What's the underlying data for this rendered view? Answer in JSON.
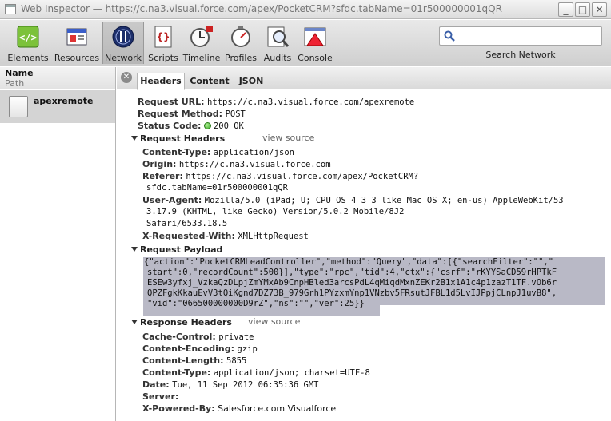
{
  "window": {
    "title": "Web Inspector — https://c.na3.visual.force.com/apex/PocketCRM?sfdc.tabName=01r500000001qQR",
    "min": "_",
    "max": "□",
    "close": "✕"
  },
  "toolbar": {
    "items": [
      {
        "label": "Elements",
        "icon": "elements-icon"
      },
      {
        "label": "Resources",
        "icon": "resources-icon"
      },
      {
        "label": "Network",
        "icon": "network-icon"
      },
      {
        "label": "Scripts",
        "icon": "scripts-icon"
      },
      {
        "label": "Timeline",
        "icon": "timeline-icon"
      },
      {
        "label": "Profiles",
        "icon": "profiles-icon"
      },
      {
        "label": "Audits",
        "icon": "audits-icon"
      },
      {
        "label": "Console",
        "icon": "console-icon"
      }
    ],
    "selected": "Network",
    "search": {
      "value": "",
      "placeholder": "",
      "caption": "Search Network"
    }
  },
  "left": {
    "header_name": "Name",
    "header_path": "Path",
    "rows": [
      {
        "name": "apexremote"
      }
    ]
  },
  "tabs": [
    {
      "label": "Headers",
      "active": true
    },
    {
      "label": "Content",
      "active": false
    },
    {
      "label": "JSON",
      "active": false
    }
  ],
  "general": {
    "url_key": "Request URL:",
    "url": "https://c.na3.visual.force.com/apexremote",
    "method_key": "Request Method:",
    "method": "POST",
    "status_key": "Status Code:",
    "status": "200 OK"
  },
  "request_headers": {
    "title": "Request Headers",
    "view_source": "view source",
    "content_type_key": "Content-Type:",
    "content_type": "application/json",
    "origin_key": "Origin:",
    "origin": "https://c.na3.visual.force.com",
    "referer_key": "Referer:",
    "referer_1": "https://c.na3.visual.force.com/apex/PocketCRM?",
    "referer_2": "sfdc.tabName=01r500000001qQR",
    "ua_key": "User-Agent:",
    "ua_1": "Mozilla/5.0 (iPad; U; CPU OS 4_3_3 like Mac OS X; en-us) AppleWebKit/53",
    "ua_2": "3.17.9 (KHTML, like Gecko) Version/5.0.2 Mobile/8J2",
    "ua_3": "Safari/6533.18.5",
    "xrw_key": "X-Requested-With:",
    "xrw": "XMLHttpRequest"
  },
  "payload": {
    "title": "Request Payload",
    "lines": [
      "{\"action\":\"PocketCRMLeadController\",\"method\":\"Query\",\"data\":[{\"searchFilter\":\"\",\"",
      "start\":0,\"recordCount\":500}],\"type\":\"rpc\",\"tid\":4,\"ctx\":{\"csrf\":\"rKYYSaCD59rHPTkF",
      "ESEw3yfxj_VzkaQzDLpjZmYMxAb9CnpHBled3arcsPdL4qMiqdMxnZEKr2B1x1A1c4p1zazT1TF.vOb6r",
      "QPZFgkKkauEvV3tQiKgnd7DZ73B_979Grh1PYzxmYnp1VNzbv5FRsutJFBL1d5LvIJPpjCLnpJ1uvB8\",",
      "\"vid\":\"066500000000D9rZ\",\"ns\":\"\",\"ver\":25}}"
    ]
  },
  "response_headers": {
    "title": "Response Headers",
    "view_source": "view source",
    "cache_key": "Cache-Control:",
    "cache": "private",
    "encoding_key": "Content-Encoding:",
    "encoding": "gzip",
    "length_key": "Content-Length:",
    "length": "5855",
    "ctype_key": "Content-Type:",
    "ctype": "application/json; charset=UTF-8",
    "date_key": "Date:",
    "date": "Tue, 11 Sep 2012 06:35:36 GMT",
    "server_key": "Server:",
    "server": "",
    "xpb_key": "X-Powered-By:",
    "xpb": "Salesforce.com Visualforce"
  }
}
